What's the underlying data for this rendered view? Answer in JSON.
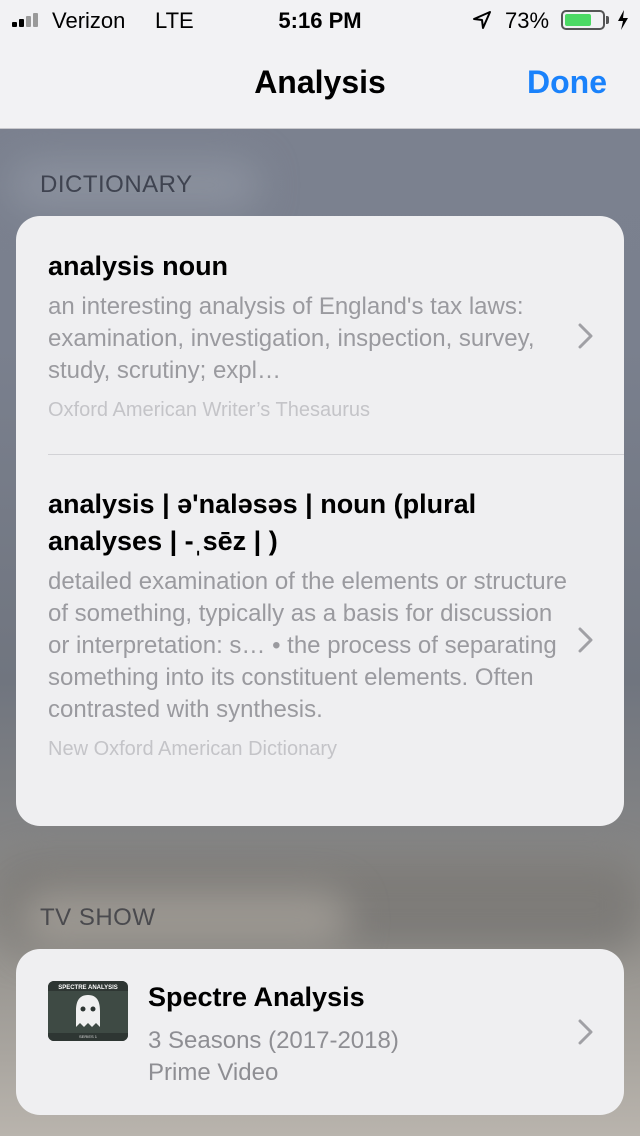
{
  "status_bar": {
    "carrier": "Verizon",
    "network": "LTE",
    "time": "5:16 PM",
    "battery_percent": "73%",
    "battery_level": 0.73,
    "battery_color": "#4cd964"
  },
  "nav": {
    "title": "Analysis",
    "done_label": "Done",
    "accent_color": "#1a82fb"
  },
  "dictionary": {
    "header": "DICTIONARY",
    "entries": [
      {
        "title": "analysis noun",
        "body": "an interesting analysis of England's tax laws: examination, investigation, inspection, survey, study, scrutiny; expl…",
        "source": "Oxford American Writer’s Thesaurus"
      },
      {
        "title": "analysis | ə'naləsəs | noun (plural analyses | -ˌsēz | )",
        "body": "detailed examination of the elements or structure of something, typically as a basis for discussion or interpretation: s… • the process of separating something into its constituent elements. Often contrasted with synthesis.",
        "source": "New Oxford American Dictionary"
      }
    ]
  },
  "tv_show": {
    "header": "TV SHOW",
    "title": "Spectre Analysis",
    "seasons": "3 Seasons (2017-2018)",
    "provider": "Prime Video",
    "art_text": "SPECTRE ANALYSIS",
    "art_subtext": "SERIES 1"
  },
  "icons": [
    "signal-bars-icon",
    "location-arrow-icon",
    "battery-icon",
    "charging-bolt-icon",
    "chevron-right-icon",
    "ghost-icon"
  ]
}
